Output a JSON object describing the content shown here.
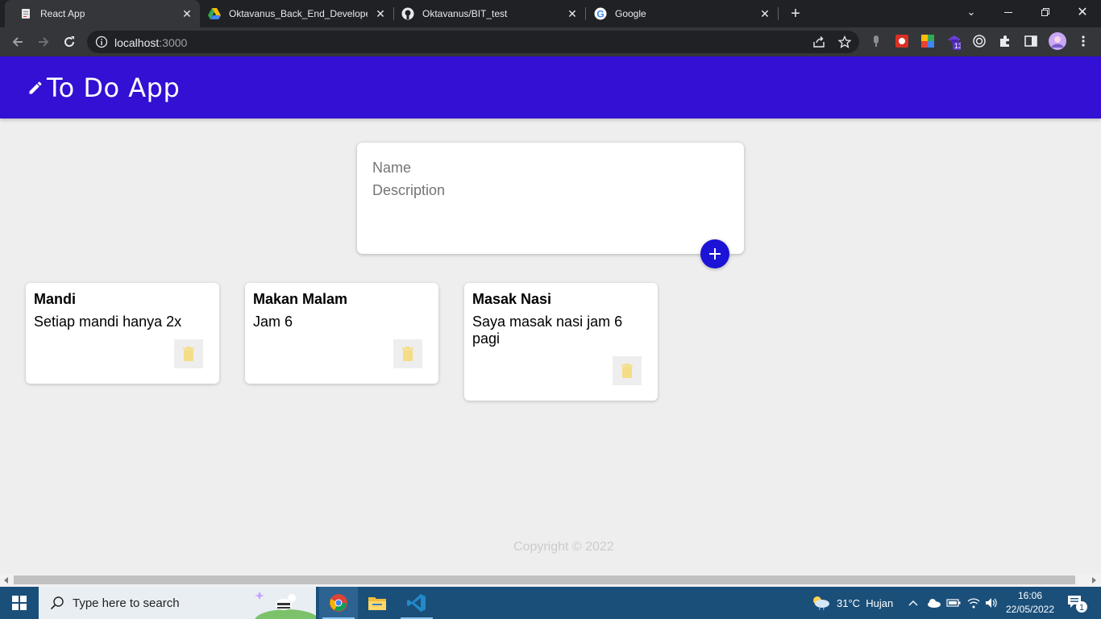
{
  "browser": {
    "tabs": [
      {
        "title": "React App",
        "active": true
      },
      {
        "title": "Oktavanus_Back_End_Developer_",
        "active": false
      },
      {
        "title": "Oktavanus/BIT_test",
        "active": false
      },
      {
        "title": "Google",
        "active": false
      }
    ],
    "url_host": "localhost",
    "url_port": ":3000",
    "extension_badge": "13"
  },
  "app": {
    "title": "To Do App",
    "form": {
      "name_placeholder": "Name",
      "description_placeholder": "Description"
    },
    "notes": [
      {
        "title": "Mandi",
        "content": "Setiap mandi hanya 2x"
      },
      {
        "title": "Makan Malam",
        "content": "Jam 6"
      },
      {
        "title": "Masak Nasi",
        "content": "Saya masak nasi jam 6 pagi"
      }
    ],
    "footer": "Copyright © 2022",
    "colors": {
      "appbar": "#3310d3",
      "add_button": "#1b13d6",
      "delete_icon": "#f5dd85"
    }
  },
  "taskbar": {
    "search_placeholder": "Type here to search",
    "weather": "31°C  Hujan",
    "time": "16:06",
    "date": "22/05/2022",
    "notification_count": "1"
  }
}
